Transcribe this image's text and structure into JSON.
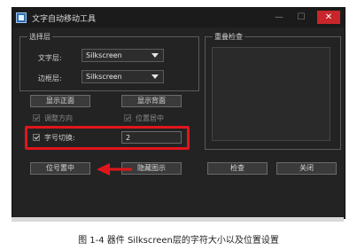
{
  "window": {
    "title": "文字自动移动工具",
    "min_glyph": "—",
    "max_glyph": "☐",
    "close_glyph": "✕"
  },
  "layer_group": {
    "title": "选择层",
    "text_layer_label": "文字层:",
    "text_layer_value": "Silkscreen",
    "border_layer_label": "边框层:",
    "border_layer_value": "Silkscreen"
  },
  "buttons": {
    "show_front": "显示正面",
    "show_back": "显示背面",
    "position_center": "位号置中",
    "hide_graphics": "隐藏图示",
    "check": "检查",
    "close": "关闭"
  },
  "options": {
    "adjust_direction": "调整方向",
    "position_center": "位置居中",
    "font_size_switch": "字号切换:",
    "font_size_value": "2"
  },
  "overlap_group": {
    "title": "重叠检查"
  },
  "caption": "图 1-4 器件 Silkscreen层的字符大小以及位置设置"
}
